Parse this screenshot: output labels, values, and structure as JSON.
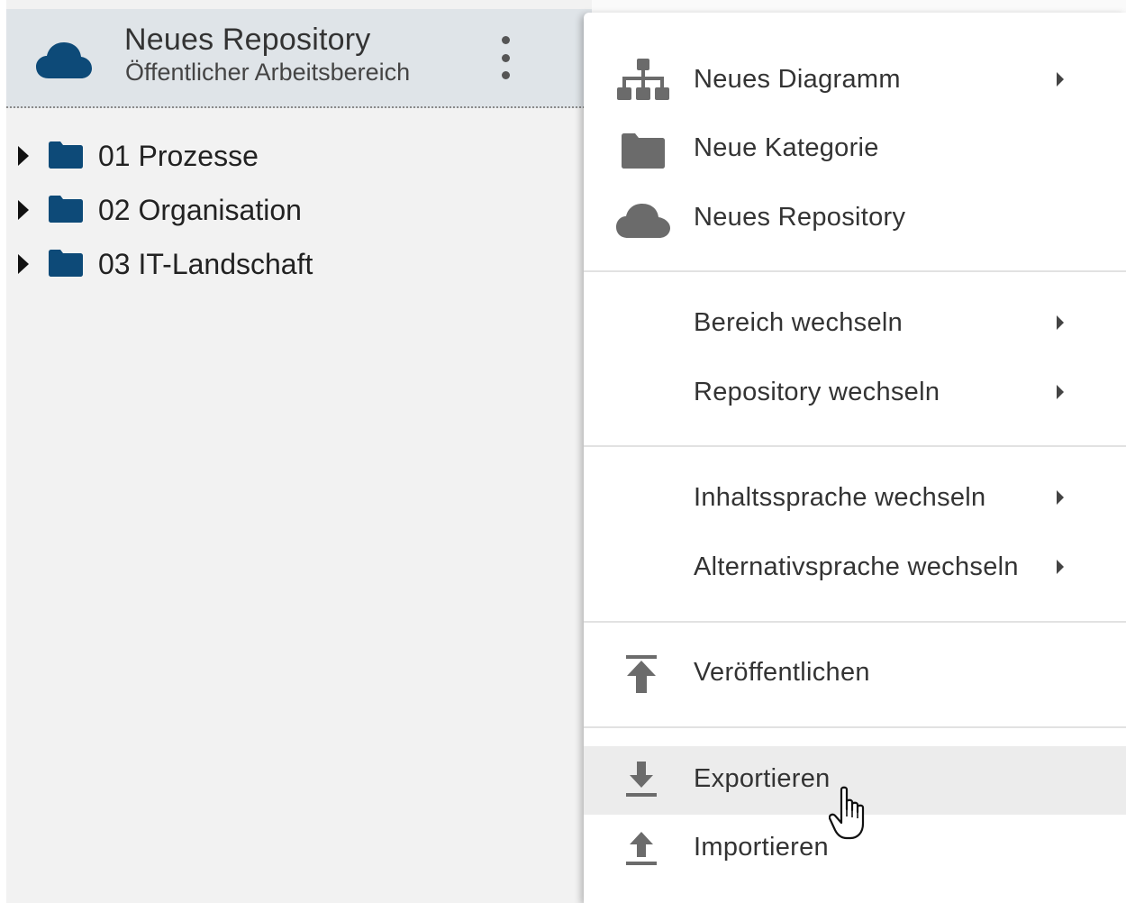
{
  "repository_panel": {
    "title": "Neues Repository",
    "subtitle": "Öffentlicher Arbeitsbereich",
    "cloud_icon": "cloud-icon",
    "more_icon": "more-vertical-icon",
    "accent_color": "#0d4a78",
    "tree_items": [
      {
        "label": "01 Prozesse",
        "icon": "folder-icon"
      },
      {
        "label": "02 Organisation",
        "icon": "folder-icon"
      },
      {
        "label": "03 IT-Landschaft",
        "icon": "folder-icon"
      }
    ]
  },
  "context_menu": {
    "items": [
      {
        "label": "Neues Diagramm",
        "icon": "hierarchy-icon",
        "has_submenu": true
      },
      {
        "label": "Neue Kategorie",
        "icon": "folder-icon",
        "has_submenu": false
      },
      {
        "label": "Neues Repository",
        "icon": "cloud-icon",
        "has_submenu": false
      },
      {
        "label": "Bereich wechseln",
        "icon": "",
        "has_submenu": true
      },
      {
        "label": "Repository wechseln",
        "icon": "",
        "has_submenu": true
      },
      {
        "label": "Inhaltssprache wechseln",
        "icon": "",
        "has_submenu": true
      },
      {
        "label": "Alternativsprache wechseln",
        "icon": "",
        "has_submenu": true
      },
      {
        "label": "Veröffentlichen",
        "icon": "publish-icon",
        "has_submenu": false
      },
      {
        "label": "Exportieren",
        "icon": "download-icon",
        "has_submenu": false,
        "hovered": true
      },
      {
        "label": "Importieren",
        "icon": "upload-icon",
        "has_submenu": false
      }
    ],
    "icon_color": "#6b6b6b",
    "hover_color": "#ececec"
  }
}
